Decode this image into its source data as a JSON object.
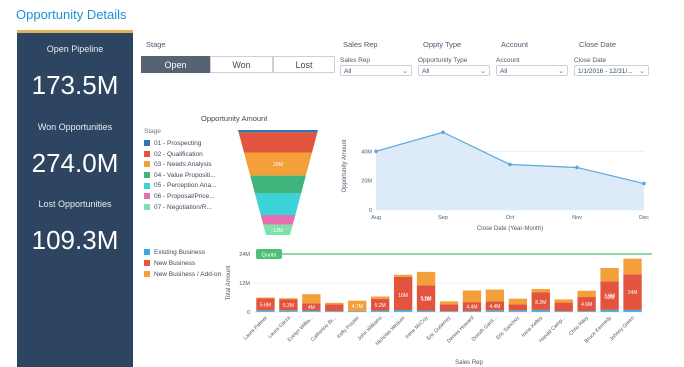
{
  "title": "Opportunity Details",
  "kpis": [
    {
      "label": "Open Pipeline",
      "value": "173.5M",
      "accent": "#e3b35a"
    },
    {
      "label": "Won Opportunities",
      "value": "274.0M",
      "accent": "#4bc076"
    },
    {
      "label": "Lost Opportunities",
      "value": "109.3M",
      "accent": "#d9534f"
    }
  ],
  "stage_label": "Stage",
  "stage_buttons": [
    "Open",
    "Won",
    "Lost"
  ],
  "filter_headers": [
    "Sales Rep",
    "Oppty Type",
    "Account",
    "Close Date"
  ],
  "filters": [
    {
      "label": "Sales Rep",
      "value": "All"
    },
    {
      "label": "Opportunity Type",
      "value": "All"
    },
    {
      "label": "Account",
      "value": "All"
    },
    {
      "label": "Close Date",
      "value": "1/1/2016 - 12/31/..."
    }
  ],
  "colors": {
    "accent": "#1f8fd6",
    "panel": "#2d4560",
    "quota": "#4bc076"
  },
  "chart_data": [
    {
      "type": "funnel",
      "title": "Opportunity Amount",
      "legend_title": "Stage",
      "categories": [
        "01 - Prospecting",
        "02 - Qualification",
        "03 - Needs Analysis",
        "04 - Value Propositi...",
        "05 - Perception Ana...",
        "06 - Proposal/Price...",
        "07 - Negotiation/R..."
      ],
      "colors": [
        "#2a7ab0",
        "#e2543d",
        "#f4a03a",
        "#3fb47c",
        "#3ad3d8",
        "#e56fb1",
        "#7fe2a9"
      ],
      "data_labels": [
        "",
        "",
        "29M",
        "",
        "",
        "",
        "13M"
      ],
      "values": [
        3,
        25,
        29,
        22,
        27,
        12,
        13
      ]
    },
    {
      "type": "area",
      "x": [
        "Aug",
        "Sep",
        "Oct",
        "Nov",
        "Dec"
      ],
      "values": [
        40,
        53,
        31,
        29,
        18
      ],
      "xlabel": "Close Date (Year-Month)",
      "ylabel": "Opportunity Amount",
      "yticks": [
        "0",
        "20M",
        "40M"
      ],
      "ylim": [
        0,
        60
      ],
      "color": "#5ca8dc"
    },
    {
      "type": "bar",
      "stacked": true,
      "categories": [
        "Laura Palmer",
        "Laura Garza",
        "Evelyn Willia...",
        "Catherine Br...",
        "Kelly Frazier",
        "John Williams",
        "Nicholas Weaver",
        "Irene McCoy",
        "Eric Gutierrez",
        "Dennis Howard",
        "Doroth Gard...",
        "Eric Sanchez",
        "Irene Kelley",
        "Harold Camp...",
        "Chris Riley",
        "Bruce Kennedy",
        "Johnny Green"
      ],
      "series": [
        {
          "name": "Existing Business",
          "color": "#3fa8dd",
          "values": [
            0.7,
            0.7,
            0.6,
            0.4,
            0.4,
            0.6,
            0.8,
            0.6,
            0.4,
            0.4,
            0.7,
            0.7,
            0.9,
            0.4,
            0.4,
            0.9,
            0.9
          ]
        },
        {
          "name": "New Business",
          "color": "#e2543d",
          "values": [
            4.9,
            4.6,
            3.0,
            2.8,
            0,
            4.8,
            13.7,
            10.4,
            2.8,
            3.7,
            3.7,
            2.5,
            7.3,
            3.5,
            5.8,
            11.8,
            14.7
          ]
        },
        {
          "name": "New Business / Add-on",
          "color": "#f4a03a",
          "values": [
            0.4,
            0.4,
            3.8,
            0.6,
            4.3,
            1.0,
            0.9,
            5.6,
            1.2,
            4.8,
            4.9,
            2.3,
            1.3,
            1.3,
            2.6,
            5.5,
            6.5
          ]
        }
      ],
      "data_labels": [
        "5.6M",
        "5.3M",
        "4M",
        "",
        "4.7M",
        "5.2M",
        "",
        "5.5M",
        "",
        "4.4M",
        "4.4M",
        "",
        "",
        "",
        "4.6M",
        "3.9M",
        "14M"
      ],
      "inner_labels": [
        "",
        "",
        "",
        "",
        "",
        "",
        "16M",
        "11M",
        "",
        "",
        "",
        "",
        "8.2M",
        "",
        "",
        "10M",
        ""
      ],
      "ylabel": "Total Amount",
      "xlabel": "Sales Rep",
      "yticks": [
        "0",
        "12M",
        "24M"
      ],
      "ylim": [
        0,
        24
      ],
      "quota": {
        "label": "Quota",
        "value": 24
      }
    }
  ]
}
